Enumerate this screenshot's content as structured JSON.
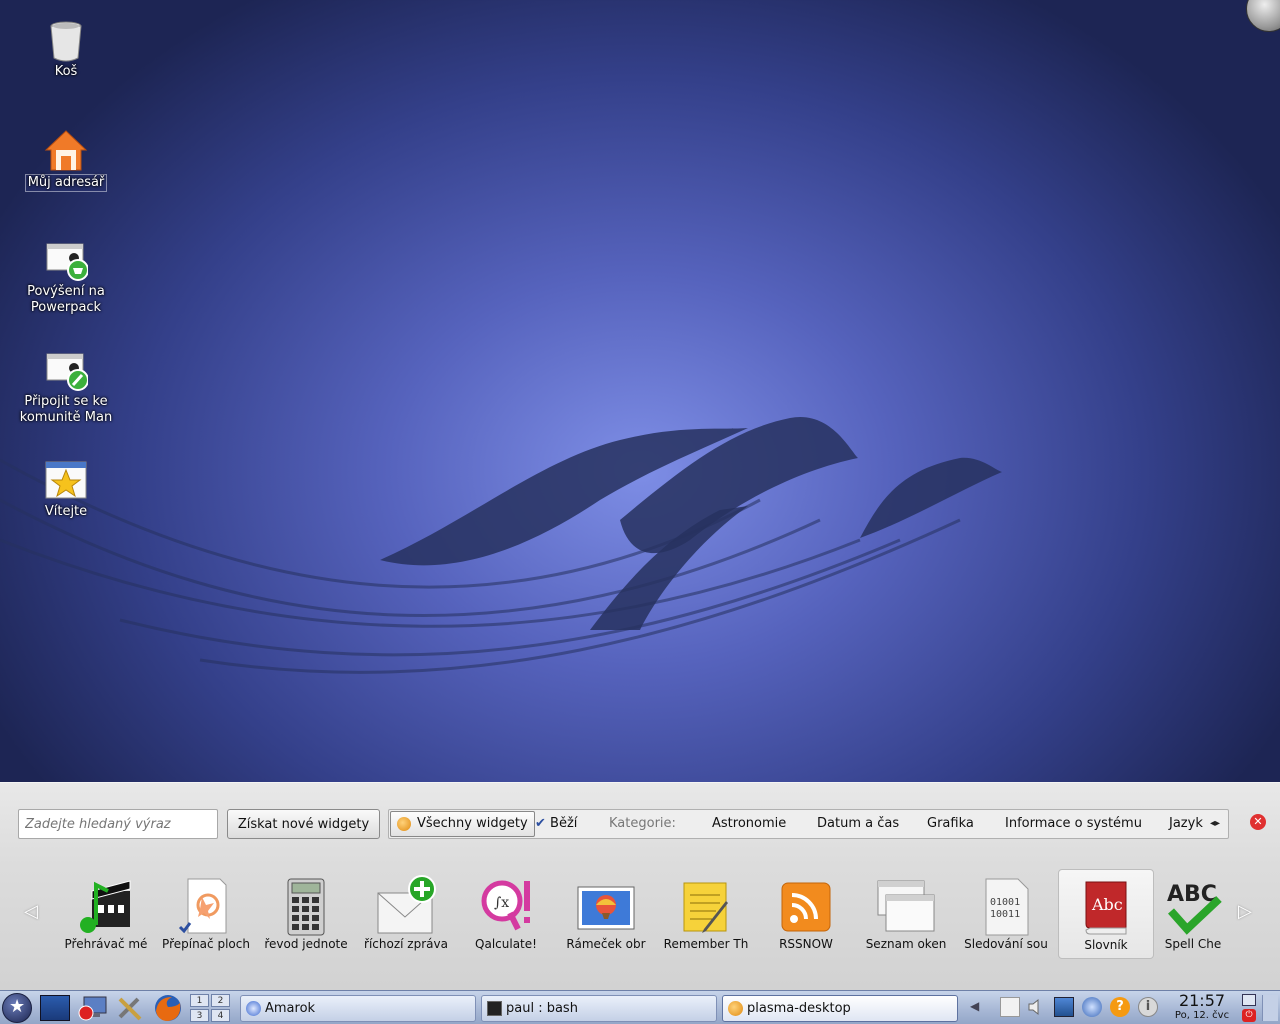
{
  "desktop": {
    "icons": [
      {
        "id": "trash",
        "label": "Koš",
        "icon": "trash-icon"
      },
      {
        "id": "home",
        "label": "Můj adresář",
        "icon": "home-icon"
      },
      {
        "id": "powerpack",
        "label": "Povýšení na Powerpack",
        "icon": "upgrade-icon"
      },
      {
        "id": "community",
        "label": "Připojit se ke komunitě Man",
        "icon": "community-icon"
      },
      {
        "id": "welcome",
        "label": "Vítejte",
        "icon": "star-icon"
      }
    ]
  },
  "explorer": {
    "search_placeholder": "Zadejte hledaný výraz",
    "get_new_label": "Získat nové widgety",
    "filters": {
      "all": "Všechny widgety",
      "running": "Běží",
      "categories_label": "Kategorie:",
      "astronomy": "Astronomie",
      "datetime": "Datum a čas",
      "graphics": "Grafika",
      "sysinfo": "Informace o systému",
      "language": "Jazyk"
    },
    "widgets": [
      {
        "label": "Přehrávač mé",
        "icon": "media-player-icon"
      },
      {
        "label": "Přepínač ploch",
        "icon": "desktop-switcher-icon"
      },
      {
        "label": "řevod jednote",
        "icon": "calculator-icon"
      },
      {
        "label": "říchozí zpráva",
        "icon": "new-mail-icon"
      },
      {
        "label": "Qalculate!",
        "icon": "qalculate-icon"
      },
      {
        "label": "Rámeček obr",
        "icon": "picture-frame-icon"
      },
      {
        "label": "Remember Th",
        "icon": "notes-icon"
      },
      {
        "label": "RSSNOW",
        "icon": "rss-icon"
      },
      {
        "label": "Seznam oken",
        "icon": "window-list-icon"
      },
      {
        "label": "Sledování sou",
        "icon": "binary-file-icon"
      },
      {
        "label": "Slovník",
        "icon": "dictionary-icon",
        "selected": true
      },
      {
        "label": "Spell Che",
        "icon": "spellcheck-icon"
      }
    ]
  },
  "taskbar": {
    "pager": [
      "1",
      "2",
      "3",
      "4"
    ],
    "tasks": [
      {
        "label": "Amarok",
        "icon": "amarok-icon"
      },
      {
        "label": "paul : bash",
        "icon": "terminal-icon"
      },
      {
        "label": "plasma-desktop",
        "icon": "plasma-icon",
        "active": true
      }
    ],
    "clock": {
      "time": "21:57",
      "date": "Po, 12. čvc"
    }
  },
  "colors": {
    "accent": "#2f3b86",
    "panel": "#a9b9d6",
    "close": "#e03030"
  }
}
